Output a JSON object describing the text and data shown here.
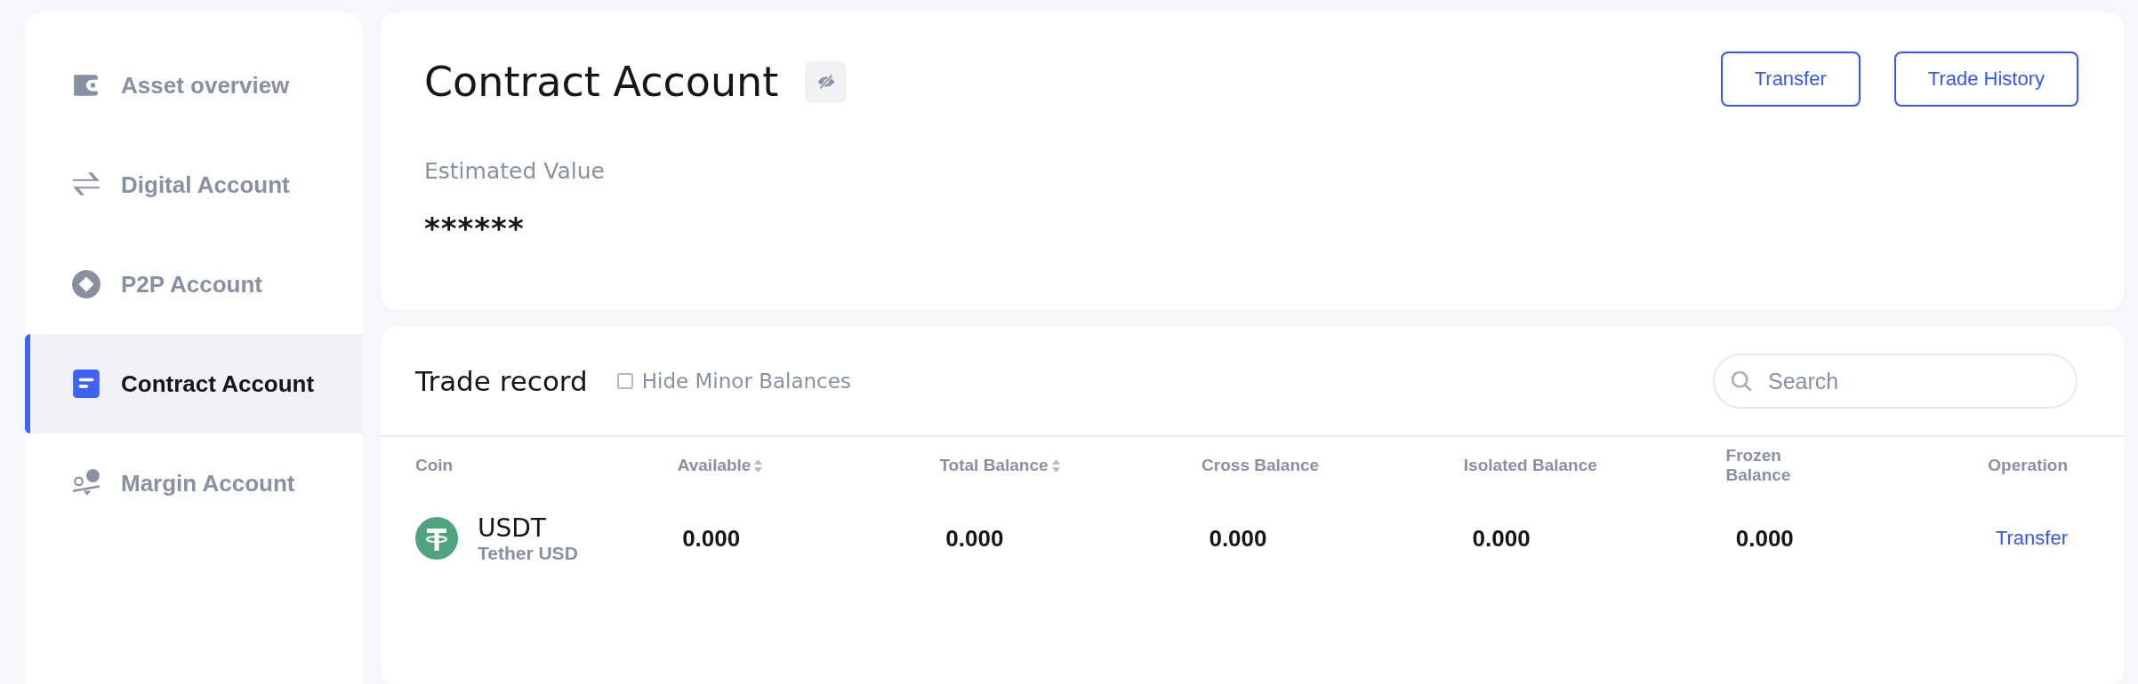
{
  "sidebar": {
    "items": [
      {
        "label": "Asset overview",
        "selected": false
      },
      {
        "label": "Digital Account",
        "selected": false
      },
      {
        "label": "P2P Account",
        "selected": false
      },
      {
        "label": "Contract Account",
        "selected": true
      },
      {
        "label": "Margin Account",
        "selected": false
      }
    ]
  },
  "account": {
    "title": "Contract Account",
    "buttons": [
      "Transfer",
      "Trade History"
    ],
    "estimated_label": "Estimated Value",
    "estimated_value": "******"
  },
  "trade_record": {
    "title": "Trade record",
    "hide_minor": {
      "label": "Hide Minor Balances",
      "checked": false
    },
    "search": {
      "placeholder": "Search"
    },
    "table": {
      "columns": [
        {
          "label": "Coin",
          "sortable": false
        },
        {
          "label": "Available",
          "sortable": true
        },
        {
          "label": "Total Balance",
          "sortable": true
        },
        {
          "label": "Cross Balance",
          "sortable": false
        },
        {
          "label": "Isolated Balance",
          "sortable": false
        },
        {
          "label": "Frozen Balance",
          "sortable": false
        },
        {
          "label": "Operation",
          "sortable": false
        }
      ],
      "rows": [
        {
          "symbol": "USDT",
          "name": "Tether USD",
          "values": [
            "0.000",
            "0.000",
            "0.000",
            "0.000",
            "0.000"
          ],
          "operation": "Transfer"
        }
      ]
    }
  }
}
